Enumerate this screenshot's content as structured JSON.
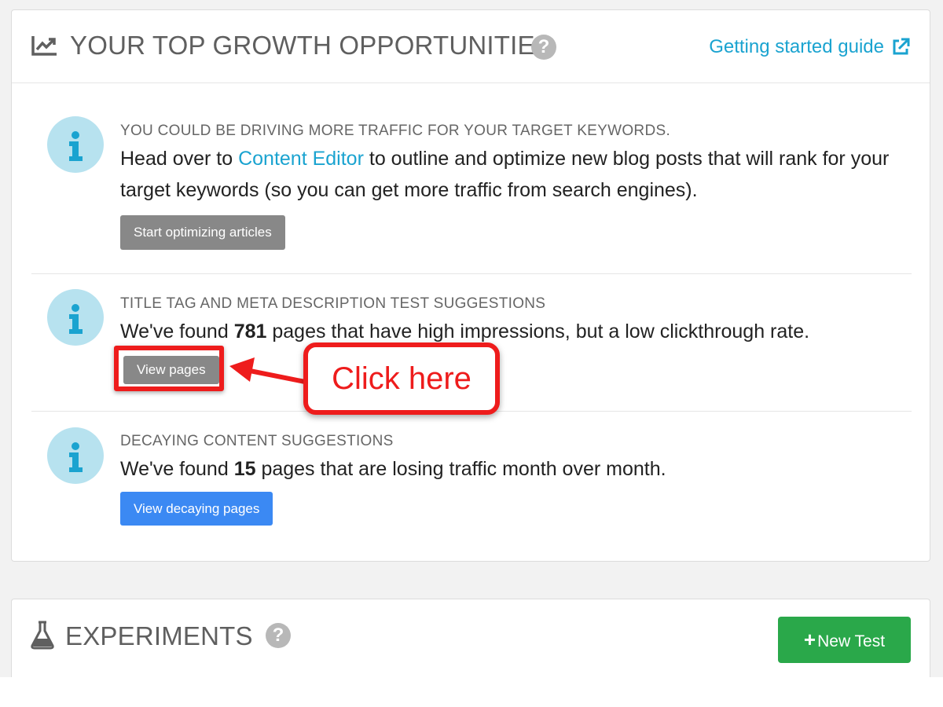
{
  "growth": {
    "title": "YOUR TOP GROWTH OPPORTUNITIES",
    "help": "?",
    "guide_link": "Getting started guide",
    "items": [
      {
        "heading": "YOU COULD BE DRIVING MORE TRAFFIC FOR YOUR TARGET KEYWORDS.",
        "text_before": "Head over to ",
        "link": "Content Editor",
        "text_after": " to outline and optimize new blog posts that will rank for your target keywords (so you can get more traffic from search engines).",
        "button": "Start optimizing articles"
      },
      {
        "heading": "TITLE TAG AND META DESCRIPTION TEST SUGGESTIONS",
        "text_before": "We've found ",
        "count": "781",
        "text_after": " pages that have high impressions, but a low clickthrough rate.",
        "button": "View pages"
      },
      {
        "heading": "DECAYING CONTENT SUGGESTIONS",
        "text_before": "We've found ",
        "count": "15",
        "text_after": " pages that are losing traffic month over month.",
        "button": "View decaying pages"
      }
    ]
  },
  "annotation": {
    "callout": "Click here"
  },
  "experiments": {
    "title": "EXPERIMENTS",
    "help": "?",
    "new_test": "New Test"
  },
  "icons": {
    "growth": "trending-chart-icon",
    "external": "external-link-icon",
    "info": "info-icon",
    "experiments": "flask-icon",
    "plus": "plus-icon"
  },
  "colors": {
    "link": "#1aa3d0",
    "annotation": "#ee1c1c",
    "primary_button": "#3b89f3",
    "success_button": "#2aa84a",
    "info_badge": "#b7e2ef"
  }
}
